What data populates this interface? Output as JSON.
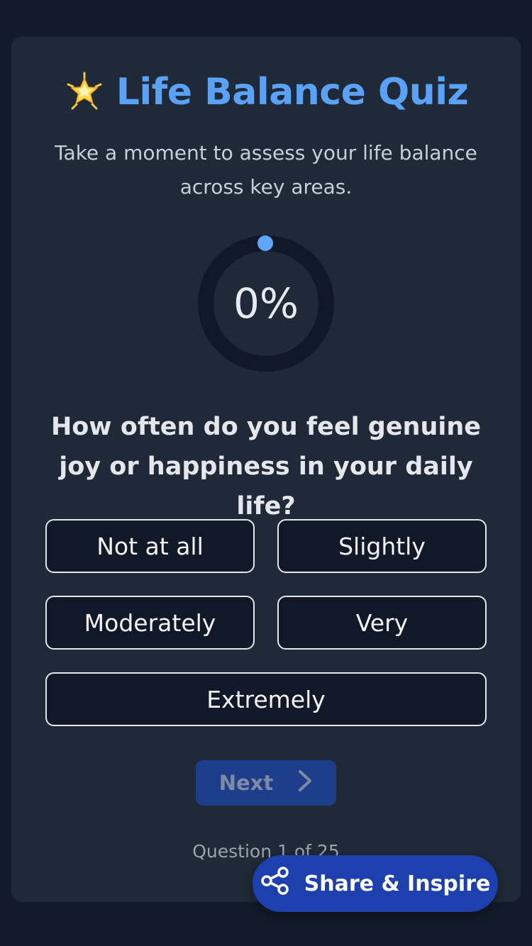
{
  "quiz": {
    "title": "Life Balance Quiz",
    "title_icon": "star-icon",
    "subtitle": "Take a moment to assess your life balance across key areas.",
    "progress_text": "0%",
    "progress_percent": 0,
    "question": "How often do you feel genuine joy or happiness in your daily life?",
    "options": [
      "Not at all",
      "Slightly",
      "Moderately",
      "Very",
      "Extremely"
    ],
    "next_label": "Next",
    "counter": "Question 1 of 25"
  },
  "share": {
    "label": "Share & Inspire",
    "icon": "share-icon"
  },
  "colors": {
    "accent": "#5aa2f8",
    "button": "#1e40af",
    "background": "#131a2a",
    "card": "#1f2937"
  }
}
